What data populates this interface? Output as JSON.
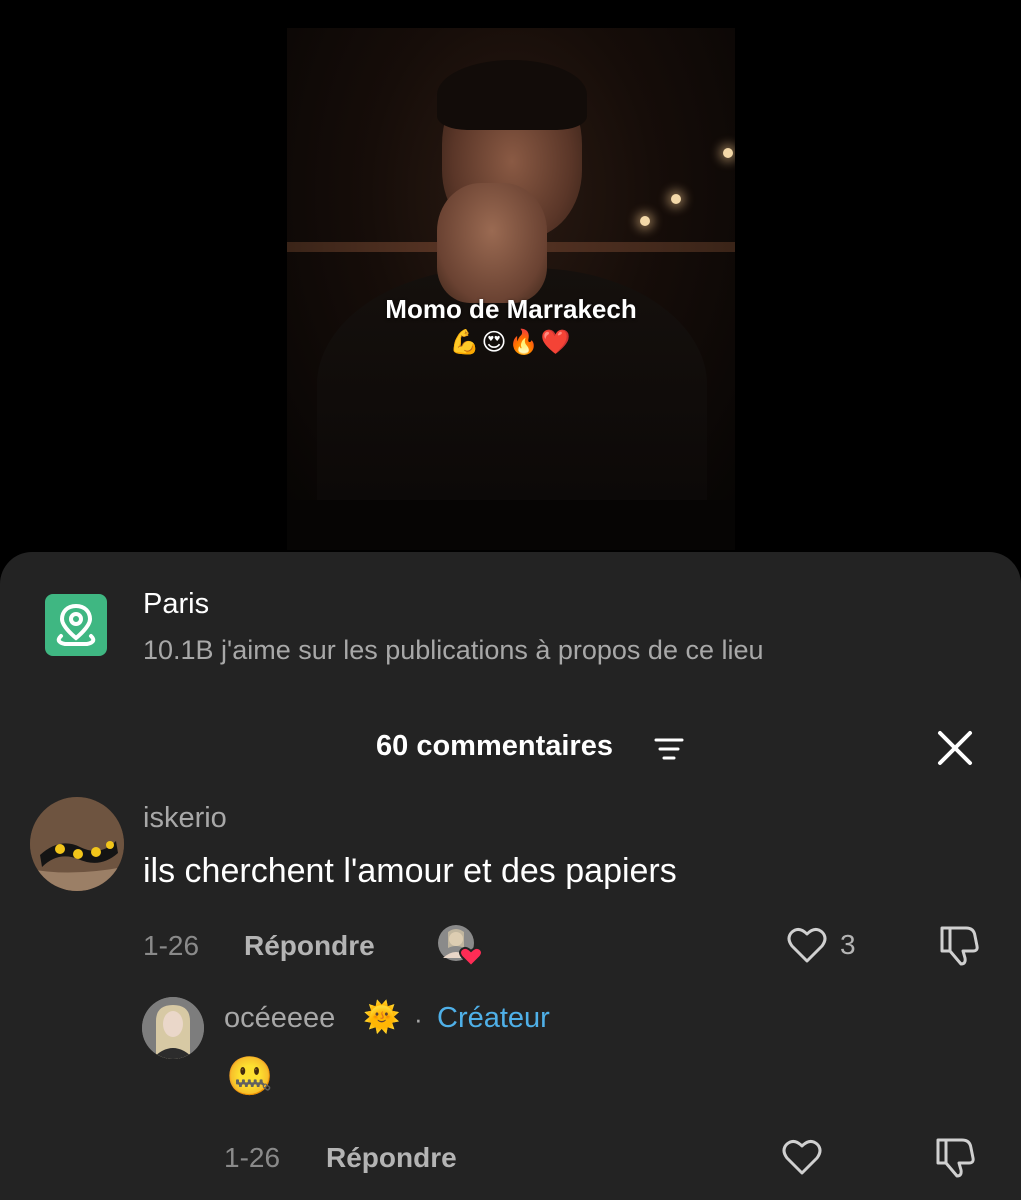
{
  "video": {
    "caption": "Momo de Marrakech",
    "caption_emoji": "💪😍🔥❤️"
  },
  "location": {
    "name": "Paris",
    "stats": "10.1B j'aime sur les publications à propos de ce lieu",
    "icon": "location-pin-icon",
    "icon_color": "#3fb782"
  },
  "comments_header": {
    "title": "60 commentaires",
    "filter_icon": "filter-icon",
    "close_icon": "close-icon"
  },
  "comments": [
    {
      "username": "iskerio",
      "text": "ils cherchent l'amour et des papiers",
      "date": "1-26",
      "reply_label": "Répondre",
      "likes": "3",
      "liked_by_creator": true,
      "replies": [
        {
          "username": "océeeee",
          "username_emoji": "🌞",
          "separator": "·",
          "badge": "Créateur",
          "badge_color": "#4fb0e8",
          "text": "🤐",
          "date": "1-26",
          "reply_label": "Répondre"
        }
      ]
    }
  ]
}
